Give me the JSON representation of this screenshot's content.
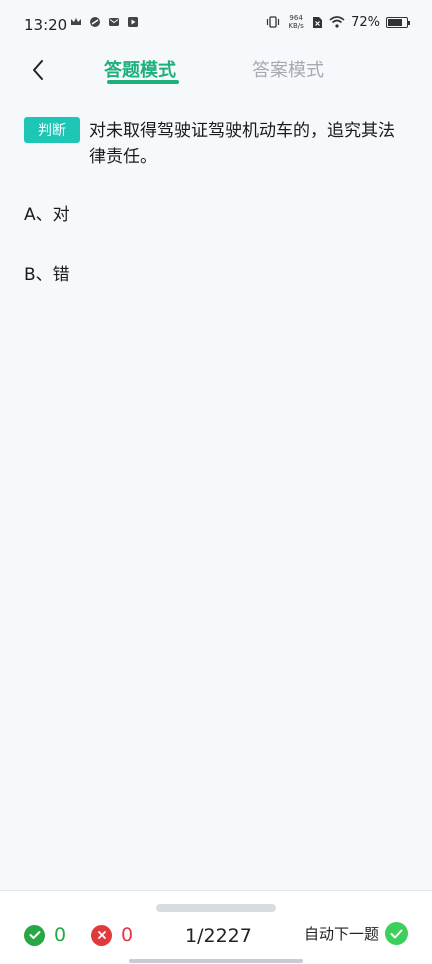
{
  "status_bar": {
    "time": "13:20",
    "net_speed_value": "964",
    "net_speed_unit": "KB/s",
    "battery_percent": "72%",
    "battery_level": 0.72
  },
  "header": {
    "tabs": [
      {
        "label": "答题模式",
        "active": true
      },
      {
        "label": "答案模式",
        "active": false
      }
    ]
  },
  "question": {
    "type_badge": "判断",
    "text": "对未取得驾驶证驾驶机动车的，追究其法律责任。",
    "options": [
      {
        "label": "A、对"
      },
      {
        "label": "B、错"
      }
    ]
  },
  "bottom_bar": {
    "correct_count": "0",
    "wrong_count": "0",
    "progress": "1/2227",
    "auto_next_label": "自动下一题"
  },
  "colors": {
    "accent": "#1db07a",
    "badge": "#1ec7b5",
    "correct": "#27a845",
    "wrong": "#e0393e"
  }
}
